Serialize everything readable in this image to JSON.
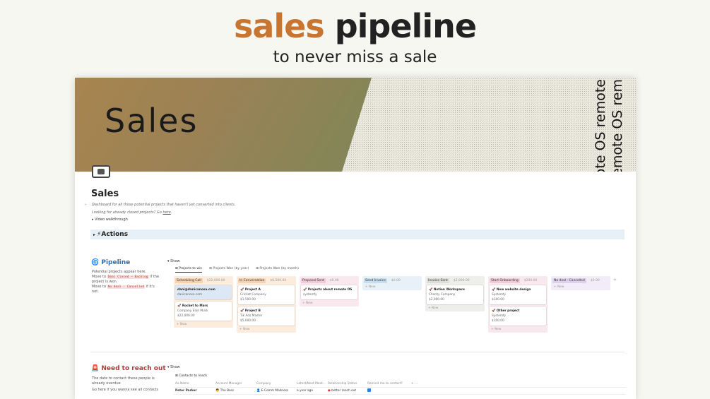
{
  "hero": {
    "title_word1": "sales",
    "title_word2": "pipeline",
    "subtitle": "to never miss a sale"
  },
  "cover": {
    "big_text": "Sales",
    "vertical_texts": [
      "remote OS remote",
      "remote OS rem"
    ]
  },
  "page": {
    "title": "Sales",
    "description_line1": "Dashboard for all those potential projects that haven't yet converted into clients.",
    "description_line2_prefix": "Looking for already closed projects? Go ",
    "description_line2_link": "here",
    "toggle_label": "Video walkthrough",
    "actions_heading": "⚡Actions"
  },
  "pipeline": {
    "heading": "Pipeline",
    "desc_line1": "Potential projects appear here.",
    "desc_move1_prefix": "Move to ",
    "desc_move1_tag": "Deal Closed — Backlog",
    "desc_move1_suffix": " if the project is won.",
    "desc_move2_prefix": "Move to ",
    "desc_move2_tag": "No deal - Cancelled",
    "desc_move2_suffix": " if it's not.",
    "show_label": "Show",
    "tabs": [
      "Projects to win",
      "Projects Won (by year)",
      "Projects Won (by month)"
    ],
    "columns": [
      {
        "name": "Scheduling Call",
        "amount": "$22,000.00",
        "bg": "#fbecdd",
        "pill": "#f5d3b2",
        "cards": [
          {
            "title": "dani@danicanosa.com",
            "lines": [
              "danicanosa.com"
            ],
            "selected": true
          },
          {
            "title": "Rocket to Mars",
            "lines": [
              "Company Elon Musk",
              "$22,000.00"
            ],
            "selected": false
          }
        ]
      },
      {
        "name": "In Conversation",
        "amount": "$6,500.00",
        "bg": "#fbecdd",
        "pill": "#f5d3b2",
        "cards": [
          {
            "title": "Project A",
            "lines": [
              "Cricket Company",
              "$1,500.00"
            ],
            "selected": false
          },
          {
            "title": "Project B",
            "lines": [
              "Tik Ads Master",
              "$5,000.00"
            ],
            "selected": false
          }
        ]
      },
      {
        "name": "Proposal Sent",
        "amount": "$0.00",
        "bg": "#f9e9ef",
        "pill": "#f2cbd9",
        "cards": [
          {
            "title": "Projects about remote OS",
            "lines": [
              "systemfy"
            ],
            "selected": false
          }
        ]
      },
      {
        "name": "Send Invoice",
        "amount": "$0.00",
        "bg": "#e8f1f8",
        "pill": "#c7def0",
        "cards": []
      },
      {
        "name": "Invoice Sent",
        "amount": "$2,000.00",
        "bg": "#eeeeec",
        "pill": "#dcdcd8",
        "cards": [
          {
            "title": "Notion Workspace",
            "lines": [
              "Charity Company",
              "$2,000.00"
            ],
            "selected": false
          }
        ]
      },
      {
        "name": "Start Onboarding",
        "amount": "$200.00",
        "bg": "#f9e9ef",
        "pill": "#f2cbd9",
        "cards": [
          {
            "title": "New website design",
            "lines": [
              "Systemfy",
              "$100.00"
            ],
            "selected": false
          },
          {
            "title": "Other project",
            "lines": [
              "Systemfy",
              "$100.00"
            ],
            "selected": false
          }
        ]
      },
      {
        "name": "No deal - Cancelled",
        "amount": "$0.00",
        "bg": "#f1ecf7",
        "pill": "#ddd2ec",
        "cards": []
      }
    ],
    "new_label": "+ New"
  },
  "reach_out": {
    "heading": "Need to reach out",
    "desc_line1": "The date to contact these people is already overdue",
    "desc_line2": "Go here if you wanna see all contacts",
    "show_label": "Show",
    "table_tab": "Contacts to reach",
    "columns": [
      "Aa Name",
      "Account Manager",
      "Company",
      "Latest/Next Meet...",
      "Relationship Status",
      "Remind me to contact?",
      "+ ···"
    ],
    "rows": [
      {
        "name": "Peter Parker",
        "manager": "The Boss",
        "company": "E-Comm Madness",
        "meet": "a year ago",
        "status": "better reach out",
        "remind": true
      }
    ]
  },
  "colors": {
    "accent_orange": "#c87530",
    "pipeline_blue": "#2f6ea7",
    "reach_red": "#b23b3b",
    "checkbox_blue": "#2383e2"
  }
}
